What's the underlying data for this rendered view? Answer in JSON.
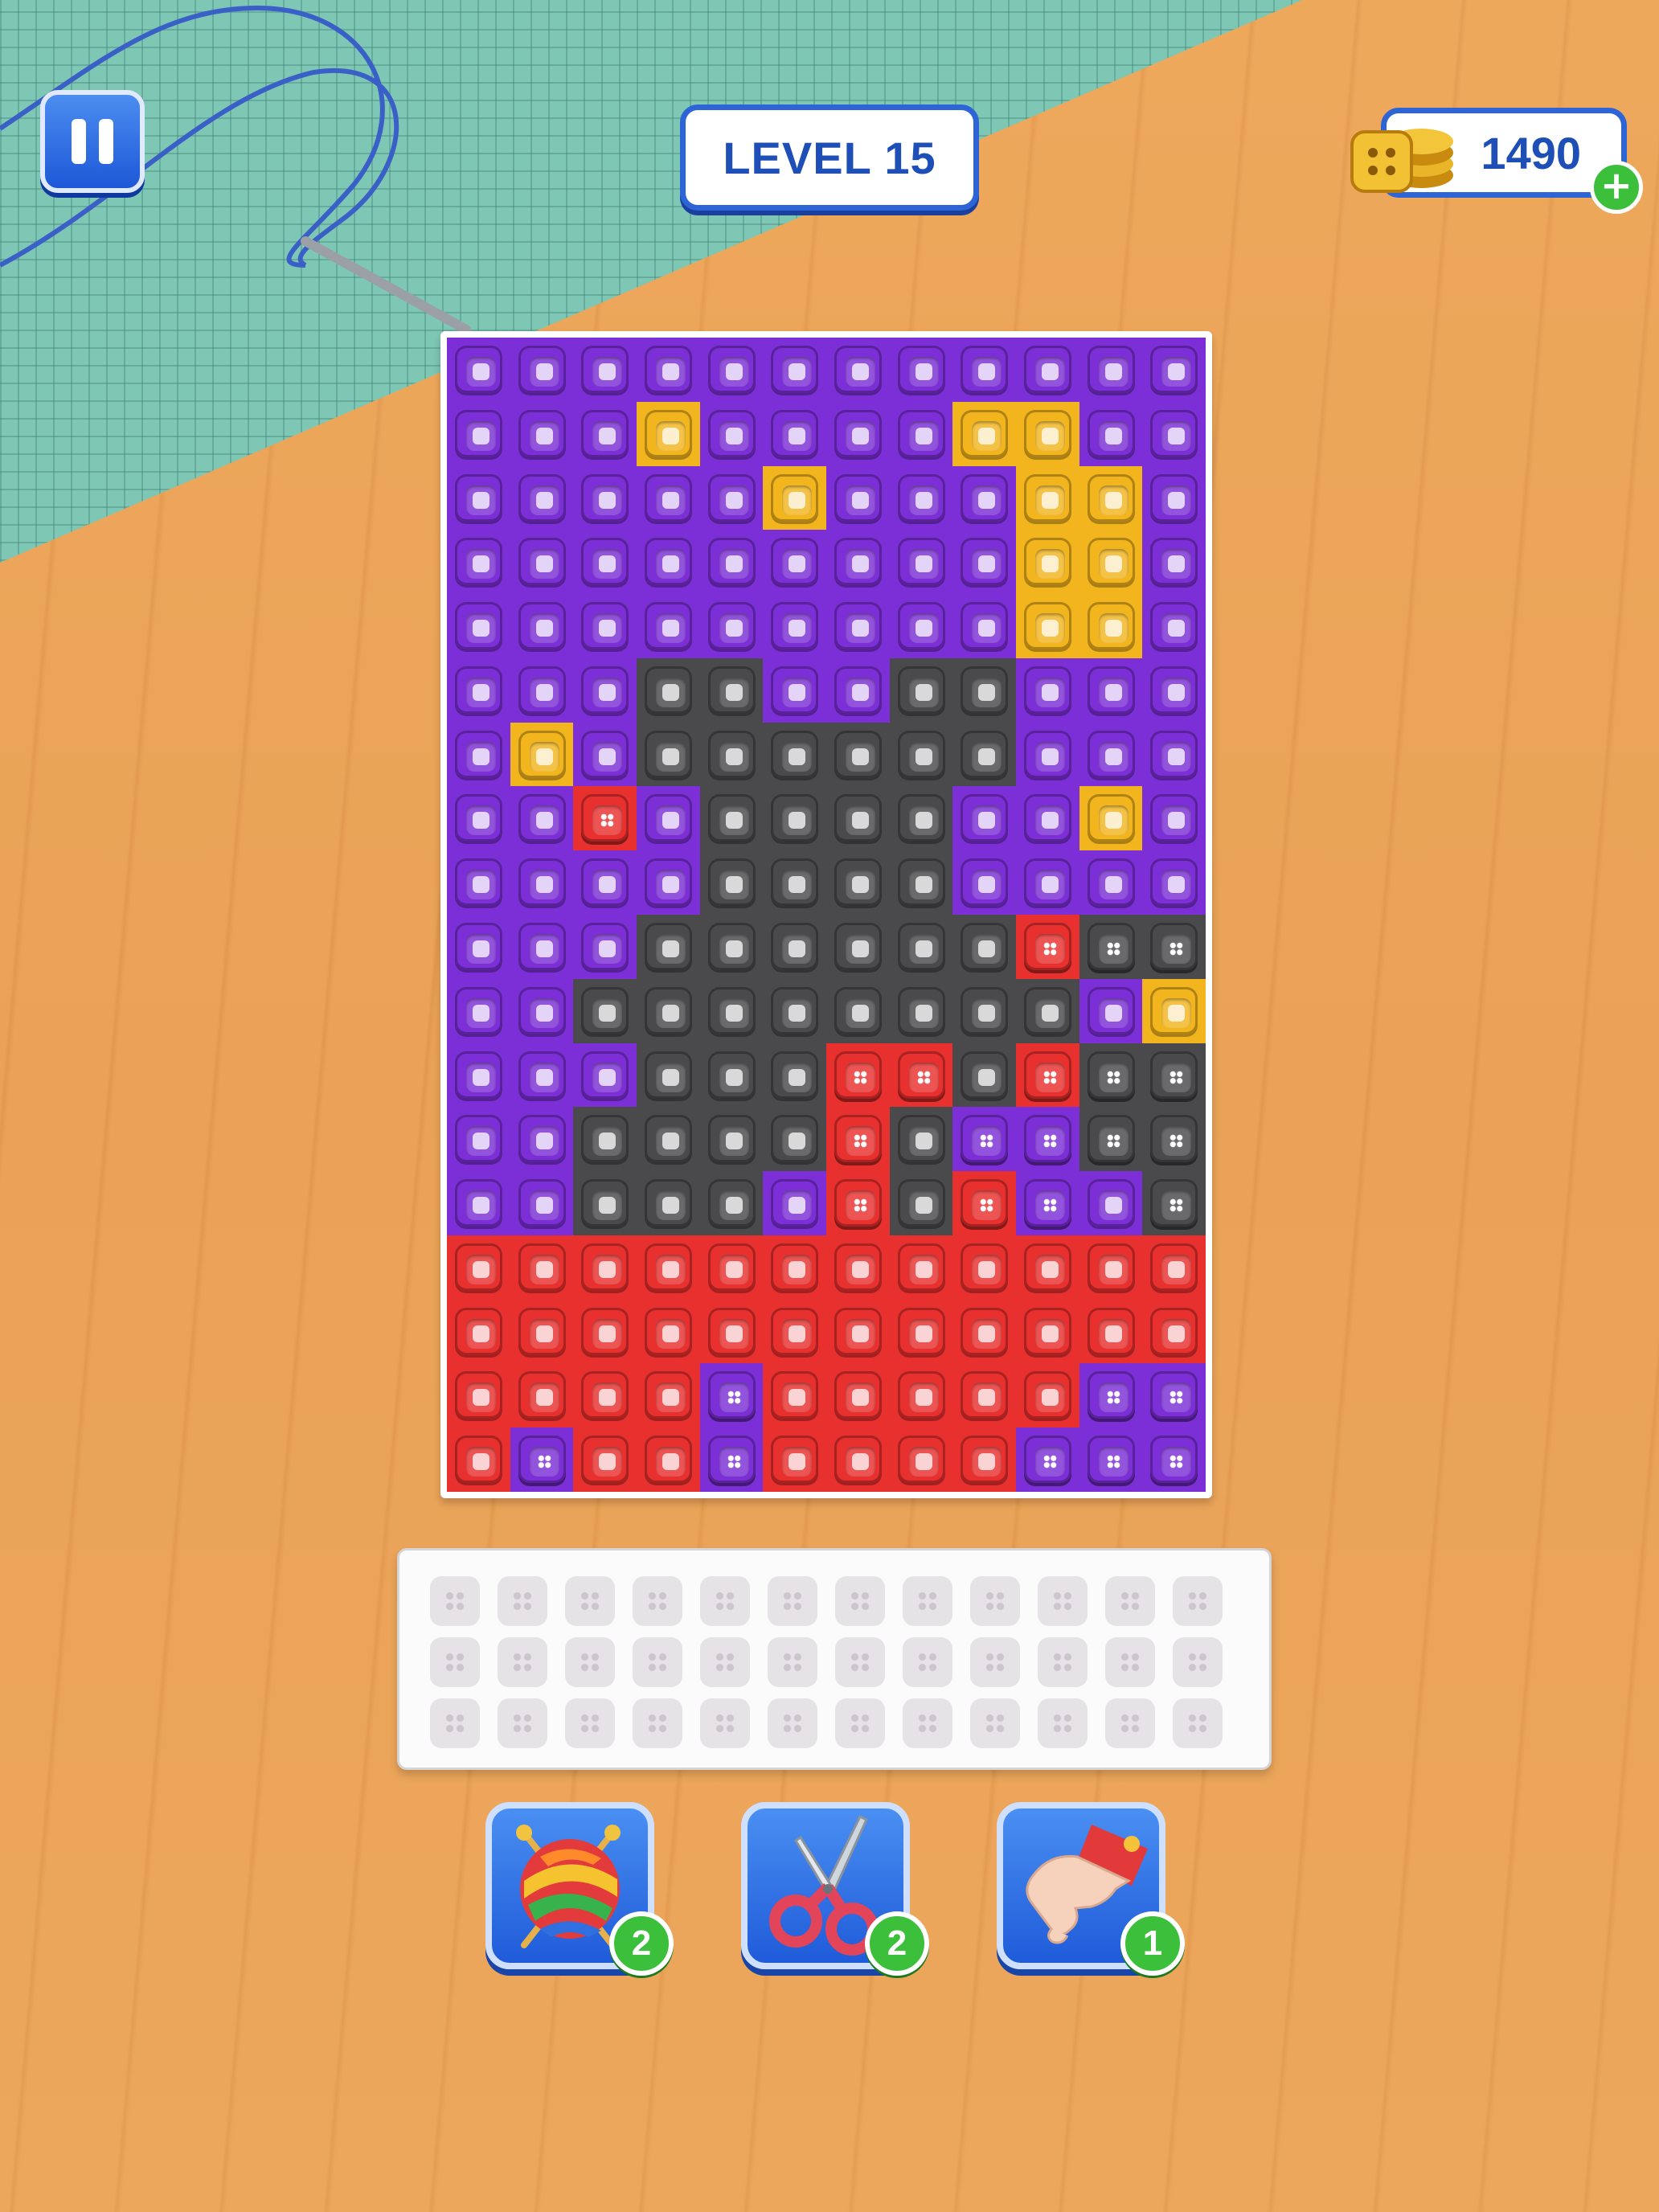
{
  "header": {
    "level_label": "LEVEL 15",
    "coins": "1490",
    "coin_plus": "+"
  },
  "palette": {
    "P": "#7c2fd6",
    "Y": "#f2b51e",
    "K": "#4a4a4c",
    "R": "#e8302e"
  },
  "board": {
    "rows": [
      "PPPPPPPPPPPP",
      "PPPYPPPPYYPP",
      "PPPPPYPPPYYP",
      "PPPPPPPPPYYP",
      "PPPPPPPPPYYP",
      "PPPKKPPKKPPP",
      "PYPKKKKKKPPP",
      "PPRPKKKKPPYP",
      "PPPPKKKKPPPP",
      "PPPKKKKKKRKK",
      "PPKKKKKKKKPY",
      "PPPKKKRRKRKK",
      "PPKKKKRKPPKK",
      "PPKKKPRKRPPK",
      "RRRRRRRRRRRR",
      "RRRRRRRRRRRR",
      "RRRRPRRRRRPP",
      "RPRRPRRRRPPP"
    ],
    "dot_buttons": [
      [
        7,
        2
      ],
      [
        9,
        9
      ],
      [
        9,
        10
      ],
      [
        9,
        11
      ],
      [
        11,
        6
      ],
      [
        11,
        7
      ],
      [
        11,
        9
      ],
      [
        11,
        10
      ],
      [
        11,
        11
      ],
      [
        12,
        6
      ],
      [
        12,
        8
      ],
      [
        12,
        9
      ],
      [
        12,
        10
      ],
      [
        12,
        11
      ],
      [
        13,
        6
      ],
      [
        13,
        8
      ],
      [
        13,
        9
      ],
      [
        13,
        11
      ],
      [
        16,
        4
      ],
      [
        16,
        10
      ],
      [
        16,
        11
      ],
      [
        17,
        1
      ],
      [
        17,
        4
      ],
      [
        17,
        9
      ],
      [
        17,
        10
      ],
      [
        17,
        11
      ]
    ]
  },
  "tray": {
    "rows": 3,
    "cols": 12
  },
  "boosters": [
    {
      "name": "yarn-ball",
      "count": "2"
    },
    {
      "name": "scissors",
      "count": "2"
    },
    {
      "name": "hand",
      "count": "1"
    }
  ]
}
